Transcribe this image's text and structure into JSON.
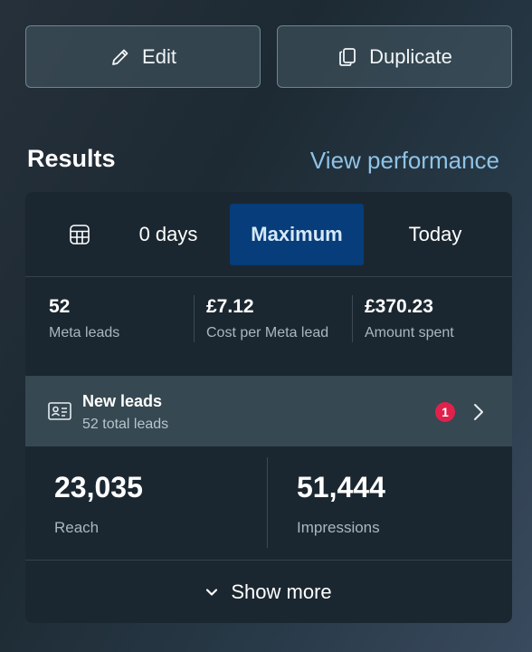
{
  "actions": {
    "edit_label": "Edit",
    "duplicate_label": "Duplicate"
  },
  "results": {
    "title": "Results",
    "view_performance": "View performance"
  },
  "date_range": {
    "options": [
      "0 days",
      "Maximum",
      "Today"
    ],
    "selected": "Maximum",
    "icon": "calendar-icon"
  },
  "metrics": [
    {
      "value": "52",
      "label": "Meta leads"
    },
    {
      "value": "£7.12",
      "label": "Cost per Meta lead"
    },
    {
      "value": "£370.23",
      "label": "Amount spent"
    }
  ],
  "new_leads": {
    "title": "New leads",
    "subtitle": "52 total leads",
    "badge": "1",
    "icon": "contact-card-icon"
  },
  "stats": [
    {
      "value": "23,035",
      "label": "Reach"
    },
    {
      "value": "51,444",
      "label": "Impressions"
    }
  ],
  "show_more_label": "Show more",
  "colors": {
    "accent_link": "#8fc3e6",
    "selected_segment": "#063d7a",
    "badge": "#e0214b",
    "card_bg": "#1b2730",
    "leads_row_bg": "#364851"
  }
}
